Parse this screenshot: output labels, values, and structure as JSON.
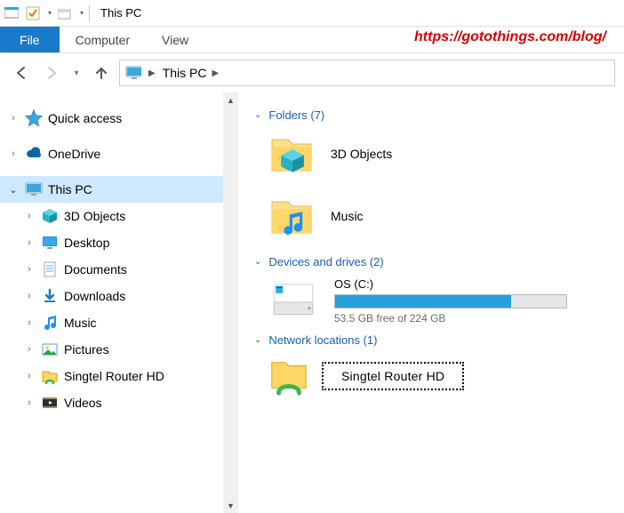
{
  "titlebar": {
    "title": "This PC"
  },
  "ribbon": {
    "file": "File",
    "tabs": [
      "Computer",
      "View"
    ]
  },
  "watermark": "https://gotothings.com/blog/",
  "address": {
    "location": "This PC"
  },
  "sidebar": {
    "items": [
      {
        "label": "Quick access",
        "glyph": "star",
        "depth": 1,
        "expanded": false,
        "selected": false
      },
      {
        "label": "OneDrive",
        "glyph": "cloud",
        "depth": 1,
        "expanded": false,
        "selected": false,
        "gapBefore": true
      },
      {
        "label": "This PC",
        "glyph": "pc",
        "depth": 1,
        "expanded": true,
        "selected": true,
        "gapBefore": true
      },
      {
        "label": "3D Objects",
        "glyph": "cube",
        "depth": 2,
        "expanded": false,
        "selected": false
      },
      {
        "label": "Desktop",
        "glyph": "desktop",
        "depth": 2,
        "expanded": false,
        "selected": false
      },
      {
        "label": "Documents",
        "glyph": "doc",
        "depth": 2,
        "expanded": false,
        "selected": false
      },
      {
        "label": "Downloads",
        "glyph": "download",
        "depth": 2,
        "expanded": false,
        "selected": false
      },
      {
        "label": "Music",
        "glyph": "music",
        "depth": 2,
        "expanded": false,
        "selected": false
      },
      {
        "label": "Pictures",
        "glyph": "pictures",
        "depth": 2,
        "expanded": false,
        "selected": false
      },
      {
        "label": "Singtel Router HD",
        "glyph": "netfolder",
        "depth": 2,
        "expanded": false,
        "selected": false
      },
      {
        "label": "Videos",
        "glyph": "videos",
        "depth": 2,
        "expanded": false,
        "selected": false
      }
    ]
  },
  "content": {
    "groups": [
      {
        "title": "Folders (7)",
        "kind": "folders",
        "items": [
          {
            "label": "3D Objects",
            "glyph": "cube"
          },
          {
            "label": "Music",
            "glyph": "music"
          }
        ]
      },
      {
        "title": "Devices and drives (2)",
        "kind": "drives",
        "items": [
          {
            "label": "OS (C:)",
            "free_text": "53.5 GB free of 224 GB",
            "used_pct": 76
          }
        ]
      },
      {
        "title": "Network locations (1)",
        "kind": "network",
        "items": [
          {
            "label": "Singtel Router HD"
          }
        ]
      }
    ]
  }
}
